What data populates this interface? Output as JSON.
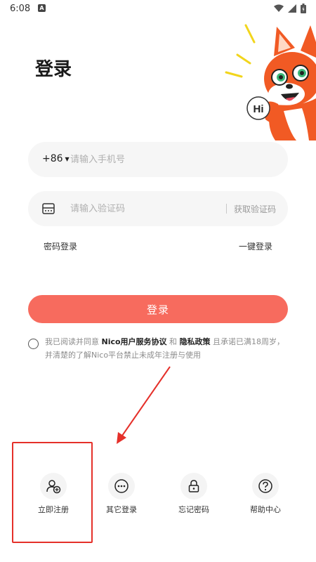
{
  "status_bar": {
    "time": "6:08",
    "notification_badge": "A",
    "icons": [
      "wifi-icon",
      "signal-icon",
      "battery-icon"
    ]
  },
  "title": "登录",
  "mascot": {
    "badge_text": "Hi"
  },
  "phone_field": {
    "country_code": "+86",
    "placeholder": "请输入手机号",
    "value": ""
  },
  "code_field": {
    "placeholder": "请输入验证码",
    "value": "",
    "get_code_label": "获取验证码"
  },
  "links": {
    "password_login": "密码登录",
    "one_key_login": "一键登录"
  },
  "login_button": "登录",
  "agreement": {
    "checked": false,
    "prefix": "我已阅读并同意 ",
    "service_terms": "Nico用户服务协议",
    "and": " 和 ",
    "privacy_policy": "隐私政策",
    "suffix": " 且承诺已满18周岁，并清楚的了解Nico平台禁止未成年注册与使用"
  },
  "bottom_actions": [
    {
      "label": "立即注册",
      "icon": "add-user-icon"
    },
    {
      "label": "其它登录",
      "icon": "more-icon"
    },
    {
      "label": "忘记密码",
      "icon": "lock-icon"
    },
    {
      "label": "帮助中心",
      "icon": "help-icon"
    }
  ],
  "colors": {
    "accent": "#f76b5e",
    "field_bg": "#f6f6f6",
    "annotation_red": "#e5302a",
    "mascot_orange": "#f15a24"
  }
}
